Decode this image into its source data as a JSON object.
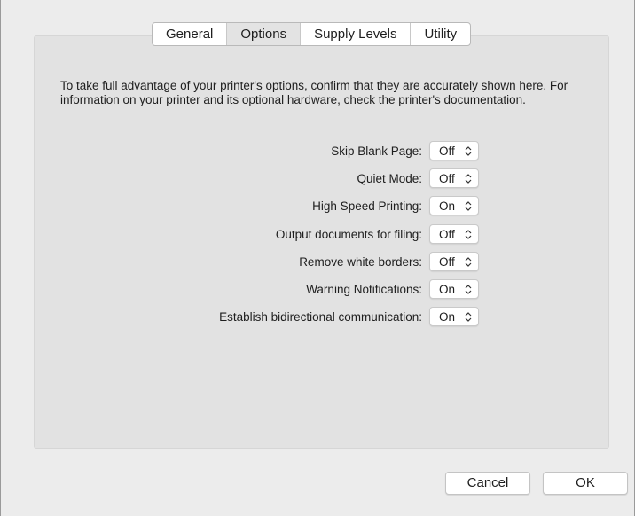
{
  "tabs": [
    {
      "label": "General"
    },
    {
      "label": "Options"
    },
    {
      "label": "Supply Levels"
    },
    {
      "label": "Utility"
    }
  ],
  "active_tab": "Options",
  "description": "To take full advantage of your printer's options, confirm that they are accurately shown here. For information on your printer and its optional hardware, check the printer's documentation.",
  "options": [
    {
      "label": "Skip Blank Page:",
      "value": "Off"
    },
    {
      "label": "Quiet Mode:",
      "value": "Off"
    },
    {
      "label": "High Speed Printing:",
      "value": "On"
    },
    {
      "label": "Output documents for filing:",
      "value": "Off"
    },
    {
      "label": "Remove white borders:",
      "value": "Off"
    },
    {
      "label": "Warning Notifications:",
      "value": "On"
    },
    {
      "label": "Establish bidirectional communication:",
      "value": "On"
    }
  ],
  "buttons": {
    "cancel": "Cancel",
    "ok": "OK"
  },
  "icons": {
    "select_arrow": "up-down-chevron-icon"
  }
}
